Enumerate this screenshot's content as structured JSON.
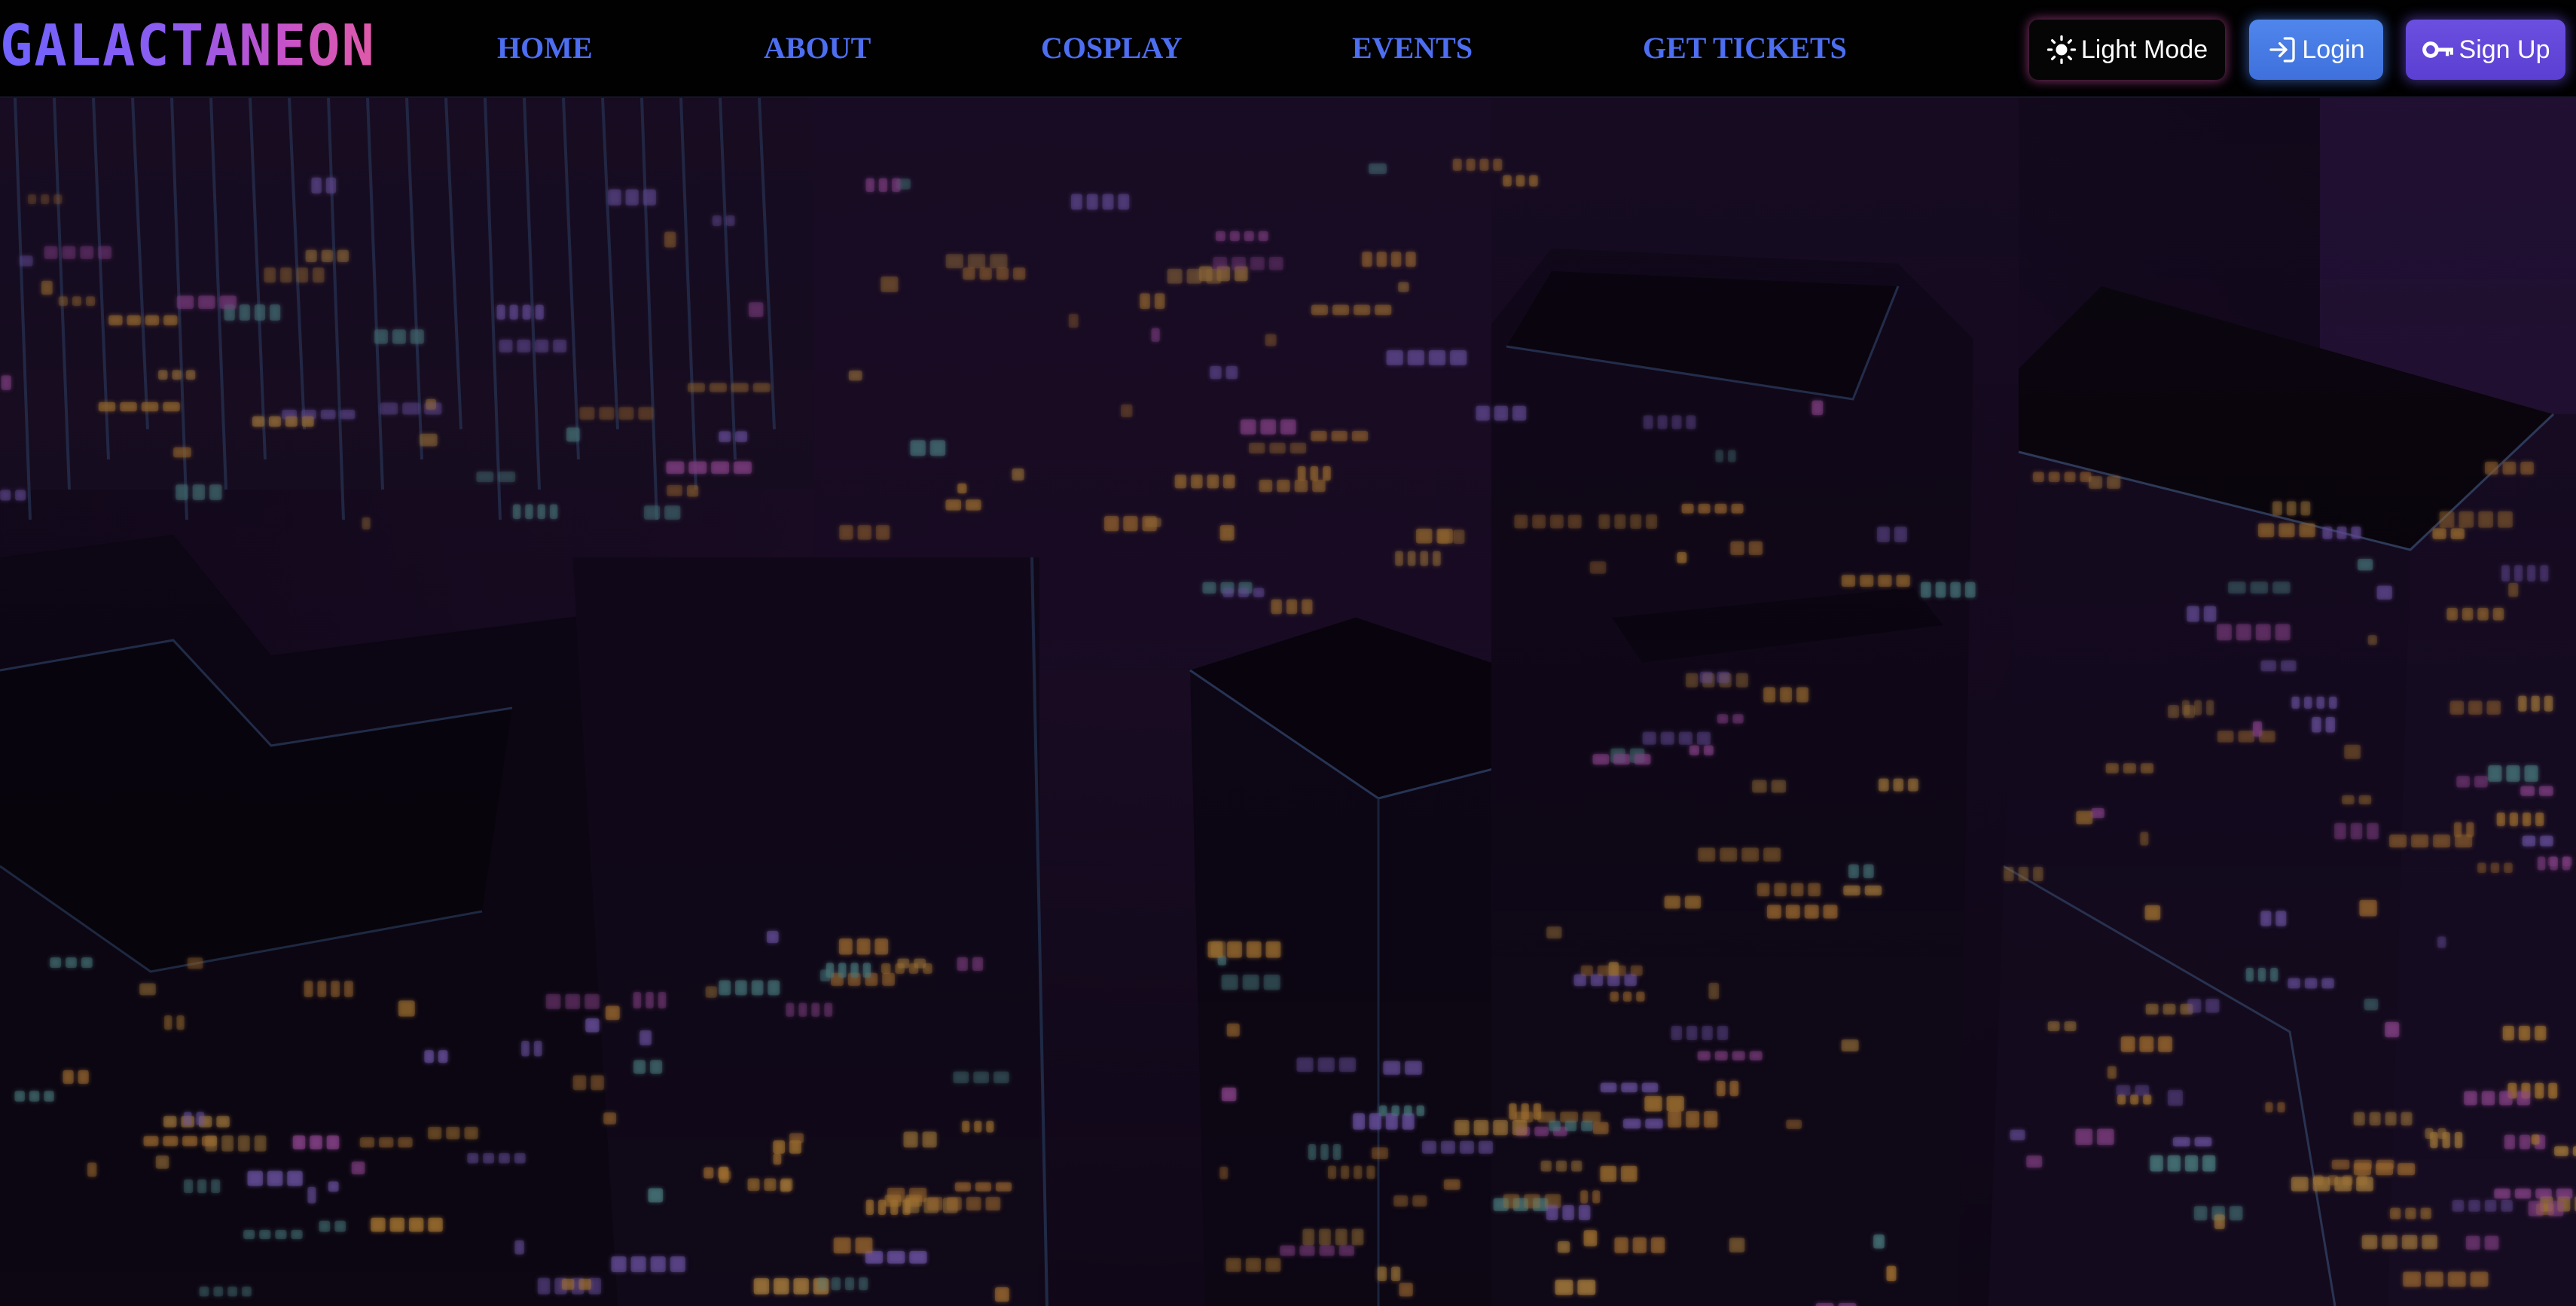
{
  "brand": {
    "logo_text": "GALACTANEON"
  },
  "nav": {
    "links": [
      {
        "label": "HOME"
      },
      {
        "label": "ABOUT"
      },
      {
        "label": "COSPLAY"
      },
      {
        "label": "EVENTS"
      },
      {
        "label": "GET TICKETS"
      }
    ]
  },
  "actions": {
    "theme_toggle": {
      "label": "Light Mode",
      "icon": "sun-icon"
    },
    "login": {
      "label": "Login",
      "icon": "login-arrow-icon"
    },
    "signup": {
      "label": "Sign Up",
      "icon": "key-icon"
    }
  },
  "colors": {
    "nav_link": "#4d6ef0",
    "logo_gradient_start": "#6f63ff",
    "logo_gradient_end": "#e05aa8",
    "login_button": "#4f86ec",
    "signup_button": "#6b4fe0",
    "theme_button_glow": "#d450aa",
    "hero_background": "#170c22"
  },
  "hero": {
    "image": "neon-city-skyline-illustration"
  }
}
